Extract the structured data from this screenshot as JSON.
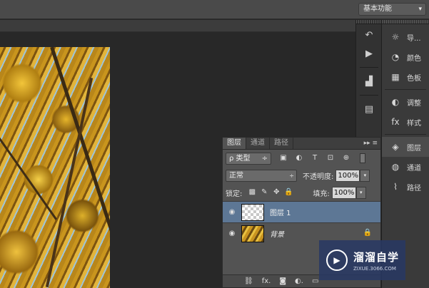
{
  "topbar": {
    "workspace_label": "基本功能",
    "workspace_arrow": "▾"
  },
  "toolstrip": {
    "icons": [
      "history-icon",
      "play-icon",
      "histogram-icon",
      "info-icon"
    ]
  },
  "right_panels": [
    {
      "icon": "☼",
      "label": "导..."
    },
    {
      "icon": "◔",
      "label": "颜色"
    },
    {
      "icon": "▦",
      "label": "色板"
    },
    {
      "icon": "◐",
      "label": "调整"
    },
    {
      "icon": "fx",
      "label": "样式"
    },
    {
      "icon": "◈",
      "label": "图层"
    },
    {
      "icon": "◍",
      "label": "通道"
    },
    {
      "icon": "⌇",
      "label": "路径"
    }
  ],
  "layers_panel": {
    "tabs": [
      "图层",
      "通道",
      "路径"
    ],
    "tab_controls": "▸▸ ≡",
    "filter": {
      "label": "ρ 类型",
      "arrow": "÷"
    },
    "filter_icons": [
      "▣",
      "◐",
      "T",
      "⊡",
      "⊕"
    ],
    "blend_mode": "正常",
    "blend_arrow": "÷",
    "opacity_label": "不透明度:",
    "opacity_value": "100%",
    "lock_label": "锁定:",
    "lock_icons": [
      "▩",
      "✎",
      "✥",
      "🔒"
    ],
    "fill_label": "填充:",
    "fill_value": "100%",
    "stepper": "▾",
    "layers": [
      {
        "name": "图层 1",
        "visible_icon": "◉",
        "selected": true
      },
      {
        "name": "背景",
        "visible_icon": "◉",
        "selected": false,
        "lock_icon": "🔒"
      }
    ],
    "bottom_icons": [
      "⛓",
      "fx.",
      "◙",
      "◐.",
      "▭"
    ]
  },
  "watermark": {
    "logo_icon": "▶",
    "title": "溜溜自学",
    "subtitle": "ZIXUE.3066.COM"
  }
}
